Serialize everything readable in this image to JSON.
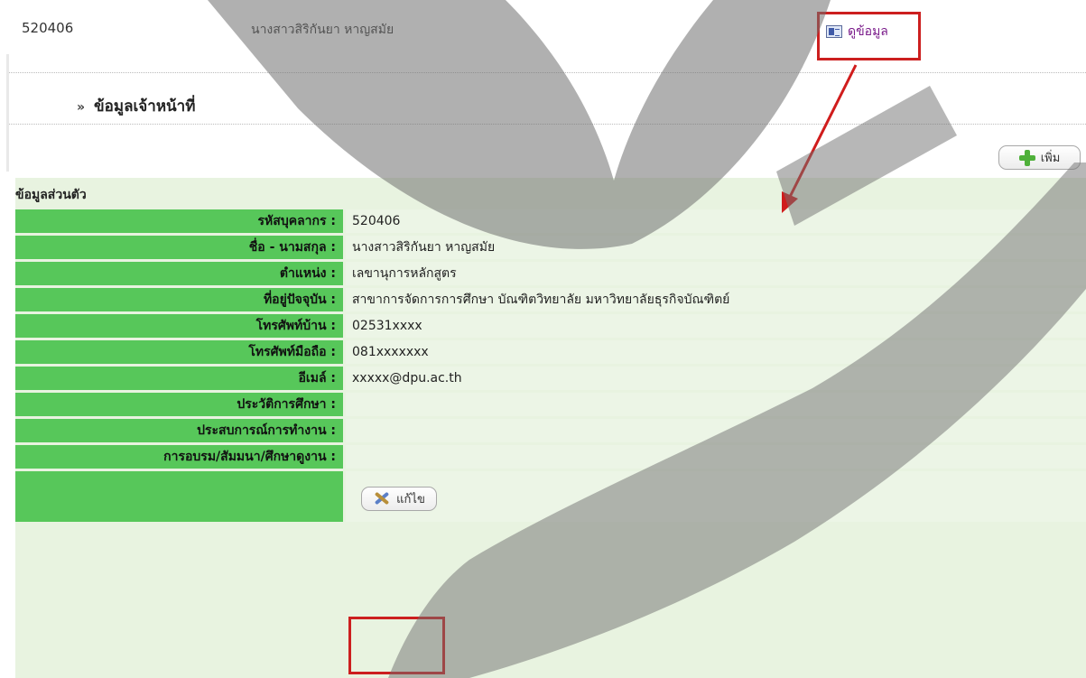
{
  "header": {
    "staff_code": "520406",
    "staff_name": "นางสาวสิริกันยา หาญสมัย",
    "view_link": "ดูข้อมูล",
    "view_icon": "profile-card-icon"
  },
  "section": {
    "bullet": "»",
    "title": "ข้อมูลเจ้าหน้าที่",
    "add_label": "เพิ่ม"
  },
  "personal": {
    "heading": "ข้อมูลส่วนตัว",
    "rows": [
      {
        "label": "รหัสบุคลากร :",
        "value": "520406"
      },
      {
        "label": "ชื่อ - นามสกุล :",
        "value": "นางสาวสิริกันยา หาญสมัย"
      },
      {
        "label": "ตำแหน่ง :",
        "value": "เลขานุการหลักสูตร"
      },
      {
        "label": "ที่อยู่ปัจจุบัน :",
        "value": "สาขาการจัดการการศึกษา บัณฑิตวิทยาลัย มหาวิทยาลัยธุรกิจบัณฑิตย์"
      },
      {
        "label": "โทรศัพท์บ้าน :",
        "value": "02531xxxx"
      },
      {
        "label": "โทรศัพท์มือถือ :",
        "value": "081xxxxxxx"
      },
      {
        "label": "อีเมล์ :",
        "value": "xxxxx@dpu.ac.th"
      },
      {
        "label": "ประวัติการศึกษา :",
        "value": ""
      },
      {
        "label": "ประสบการณ์การทำงาน :",
        "value": ""
      },
      {
        "label": "การอบรม/สัมมนา/ศึกษาดูงาน :",
        "value": ""
      }
    ],
    "edit_label": "แก้ไข"
  },
  "colors": {
    "label_bg": "#57c75a",
    "panel_bg": "#e8f3e0",
    "highlight": "#cc1f1f",
    "link": "#7a1b8a"
  }
}
